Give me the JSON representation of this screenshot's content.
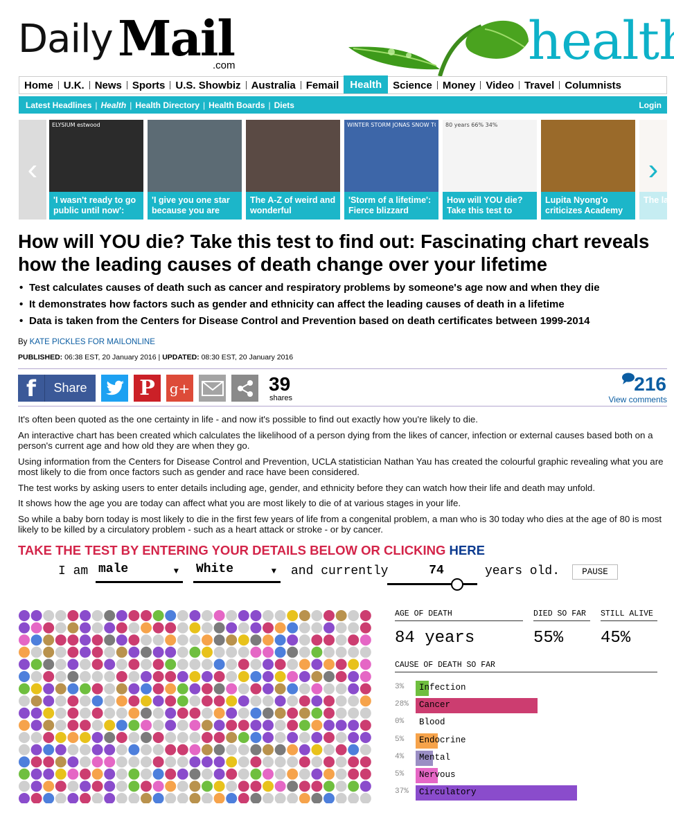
{
  "header": {
    "logo_daily": "Daily",
    "logo_mail": "Mail",
    "logo_com": ".com",
    "section_word": "health"
  },
  "nav": {
    "main": [
      "Home",
      "U.K.",
      "News",
      "Sports",
      "U.S. Showbiz",
      "Australia",
      "Femail",
      "Health",
      "Science",
      "Money",
      "Video",
      "Travel",
      "Columnists"
    ],
    "active": "Health",
    "sub": [
      "Latest Headlines",
      "Health",
      "Health Directory",
      "Health Boards",
      "Diets"
    ],
    "login": "Login"
  },
  "carousel": {
    "prev_arrow": "‹",
    "next_arrow": "›",
    "items": [
      {
        "caption": "'I wasn't ready to go public until now':",
        "color": "#2b2b2b",
        "overlay": "ELYSIUM   estwood"
      },
      {
        "caption": "'I give you one star because you are",
        "color": "#5c6b74",
        "overlay": ""
      },
      {
        "caption": "The A-Z of weird and wonderful",
        "color": "#5a4a44",
        "overlay": ""
      },
      {
        "caption": "'Storm of a lifetime': Fierce blizzard",
        "color": "#3d66a8",
        "overlay": "WINTER STORM JONAS  SNOW TOTAL FORECAST"
      },
      {
        "caption": "How will YOU die? Take this test to",
        "color": "#f4f4f4",
        "overlay": "80 years   66%   34%"
      },
      {
        "caption": "Lupita Nyong'o criticizes Academy",
        "color": "#9a6a2a",
        "overlay": ""
      },
      {
        "caption": "The la EVER",
        "color": "#e7d9cf",
        "overlay": ""
      }
    ]
  },
  "article": {
    "headline": "How will YOU die? Take this test to find out: Fascinating chart reveals how the leading causes of death change over your lifetime",
    "bullets": [
      "Test calculates causes of death such as cancer and respiratory problems by someone's age now and when they die",
      "It demonstrates how factors such as gender and ethnicity can affect the leading causes of death in a lifetime",
      "Data is taken from the Centers for Disease Control and Prevention based on death certificates between 1999-2014"
    ],
    "byline_prefix": "By",
    "author": "KATE PICKLES FOR MAILONLINE",
    "published_label": "PUBLISHED:",
    "published": "06:38 EST, 20 January 2016",
    "sep": "|",
    "updated_label": "UPDATED:",
    "updated": "08:30 EST, 20 January 2016",
    "paragraphs": [
      "It's often been quoted as the one certainty in life - and now it's possible to find out exactly how you're likely to die.",
      "An interactive chart has been created which calculates the likelihood of a person dying from the likes of cancer, infection or external causes based both on a person's current age and how old they are when they go.",
      "Using information from the Centers for Disease Control and Prevention, UCLA statistician Nathan Yau has created the colourful graphic revealing what you are most likely to die from once factors such as gender and race have been considered.",
      "The test works by asking users to enter details including age, gender, and ethnicity before they can watch how their life and death may unfold.",
      "It shows how the age you are today can affect what you are most likely to die of at various stages in your life.",
      "So while a baby born today is most likely to die in the first few years of life from a congenital problem, a man who is 30 today who dies at the age of 80 is most likely to be killed by a circulatory problem - such as a heart attack or stroke - or by cancer."
    ],
    "cta": "TAKE THE TEST BY ENTERING YOUR DETAILS BELOW OR CLICKING",
    "cta_link": "HERE"
  },
  "share": {
    "facebook_label": "Share",
    "count": "39",
    "count_label": "shares",
    "comments": "216",
    "view_comments": "View comments",
    "colors": {
      "facebook": "#3b5998",
      "twitter": "#1da1f2",
      "pinterest": "#cb2027",
      "google": "#dd4b39",
      "email": "#9e9e9e",
      "more": "#8a8a8a"
    }
  },
  "controls": {
    "i_am": "I am",
    "gender": "male",
    "race": "White",
    "and_currently": "and currently",
    "age": "74",
    "years_old": "years old.",
    "pause": "PAUSE"
  },
  "stats": {
    "age_of_death_label": "AGE OF DEATH",
    "age_of_death": "84 years",
    "died_label": "DIED SO FAR",
    "died": "55%",
    "alive_label": "STILL ALIVE",
    "alive": "45%",
    "cause_label": "CAUSE OF DEATH SO FAR",
    "causes": [
      {
        "name": "Infection",
        "pct": "3%",
        "value": 3,
        "color": "#6fbf3f"
      },
      {
        "name": "Cancer",
        "pct": "28%",
        "value": 28,
        "color": "#cc3d70"
      },
      {
        "name": "Blood",
        "pct": "0%",
        "value": 0,
        "color": "#d94f4f"
      },
      {
        "name": "Endocrine",
        "pct": "5%",
        "value": 5,
        "color": "#f6a34b"
      },
      {
        "name": "Mental",
        "pct": "4%",
        "value": 4,
        "color": "#9a8ec4"
      },
      {
        "name": "Nervous",
        "pct": "5%",
        "value": 5,
        "color": "#e567c5"
      },
      {
        "name": "Circulatory",
        "pct": "37%",
        "value": 37,
        "color": "#8a4ccc"
      }
    ]
  }
}
